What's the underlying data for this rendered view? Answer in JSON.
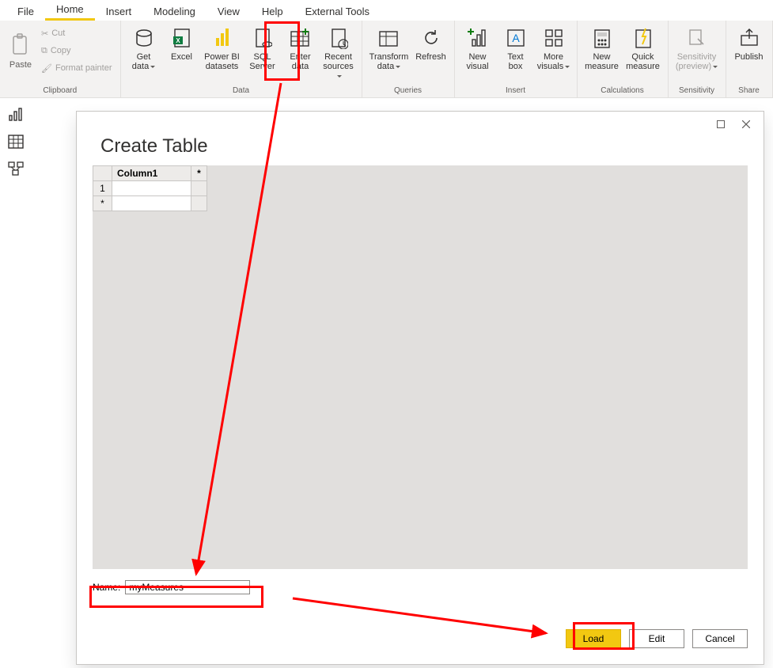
{
  "tabs": {
    "file": "File",
    "home": "Home",
    "insert": "Insert",
    "modeling": "Modeling",
    "view": "View",
    "help": "Help",
    "external": "External Tools"
  },
  "ribbon": {
    "clipboard": {
      "label": "Clipboard",
      "paste": "Paste",
      "cut": "Cut",
      "copy": "Copy",
      "format_painter": "Format painter"
    },
    "data": {
      "label": "Data",
      "get_data": "Get\ndata",
      "excel": "Excel",
      "pbi_datasets": "Power BI\ndatasets",
      "sql_server": "SQL\nServer",
      "enter_data": "Enter\ndata",
      "recent_sources": "Recent\nsources"
    },
    "queries": {
      "label": "Queries",
      "transform": "Transform\ndata",
      "refresh": "Refresh"
    },
    "insert": {
      "label": "Insert",
      "new_visual": "New\nvisual",
      "text_box": "Text\nbox",
      "more_visuals": "More\nvisuals"
    },
    "calculations": {
      "label": "Calculations",
      "new_measure": "New\nmeasure",
      "quick_measure": "Quick\nmeasure"
    },
    "sensitivity": {
      "label": "Sensitivity",
      "btn": "Sensitivity\n(preview)"
    },
    "share": {
      "label": "Share",
      "publish": "Publish"
    }
  },
  "dialog": {
    "title": "Create Table",
    "col_header": "Column1",
    "row1": "1",
    "row_star": "*",
    "col_star": "*",
    "name_label": "Name:",
    "name_value": "myMeasures",
    "load": "Load",
    "edit": "Edit",
    "cancel": "Cancel"
  }
}
